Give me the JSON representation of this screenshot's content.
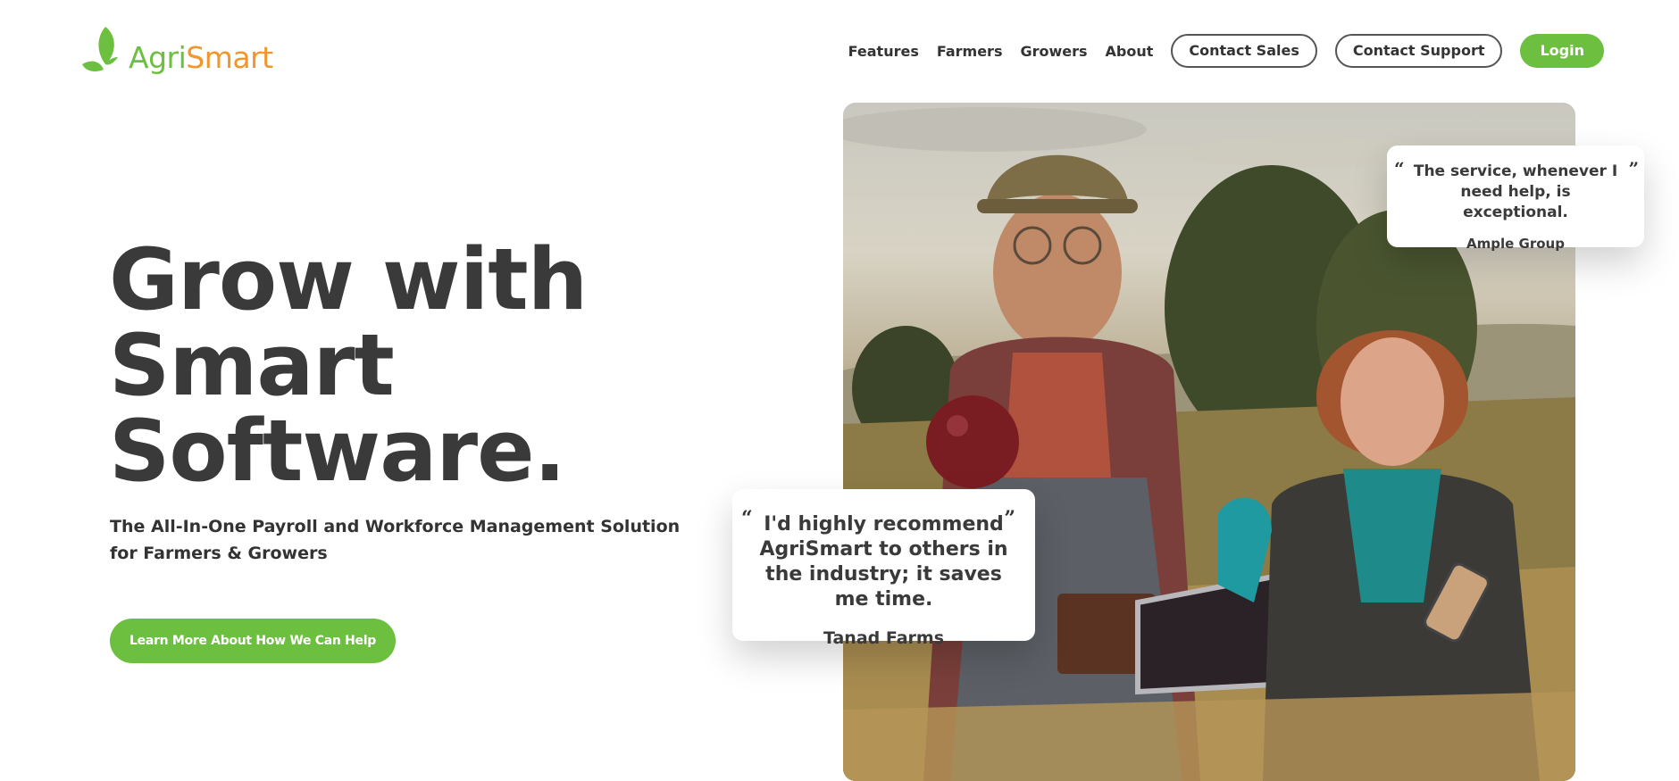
{
  "brand": {
    "name_part1": "Agri",
    "name_part2": "Smart",
    "logo_icon": "leaf-icon",
    "colors": {
      "green": "#6cbf3f",
      "orange": "#f0962b",
      "text": "#3a3a3a"
    }
  },
  "nav": {
    "links": [
      "Features",
      "Farmers",
      "Growers",
      "About"
    ],
    "contact_sales": "Contact Sales",
    "contact_support": "Contact Support",
    "login": "Login"
  },
  "hero": {
    "title_lines": [
      "Grow with",
      "Smart",
      "Software."
    ],
    "subtitle": "The All-In-One Payroll and Workforce Management Solution for Farmers & Growers",
    "cta": "Learn More About How We Can Help"
  },
  "testimonials": [
    {
      "quote": "The service, whenever I need help, is exceptional.",
      "author": "Ample Group"
    },
    {
      "quote": "I'd highly recommend AgriSmart to others in the industry; it saves me time.",
      "author": "Tanad Farms"
    }
  ],
  "quote_marks": {
    "open": "“",
    "close": "”"
  }
}
